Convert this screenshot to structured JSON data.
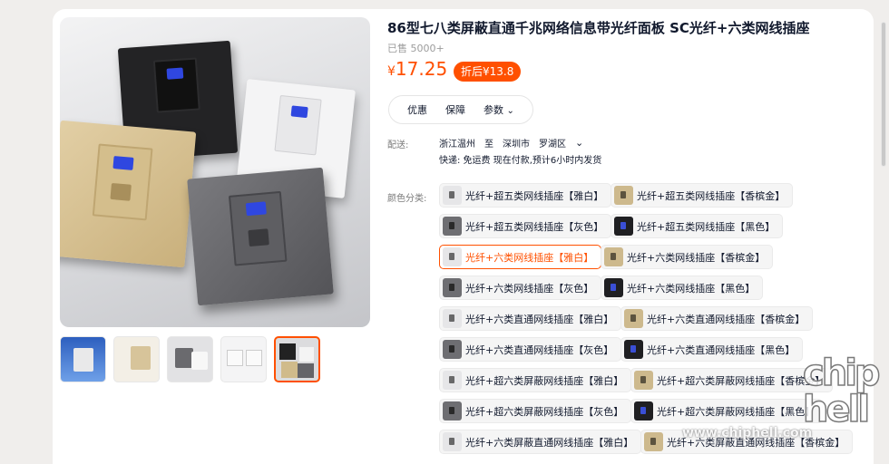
{
  "product": {
    "title": "86型七八类屏蔽直通千兆网络信息带光纤面板 SC光纤+六类网线插座",
    "sold": "已售 5000+",
    "price_symbol": "¥",
    "price": "17.25",
    "coupon": "折后¥13.8"
  },
  "chips": [
    {
      "label": "优惠"
    },
    {
      "label": "保障"
    },
    {
      "label": "参数"
    }
  ],
  "delivery": {
    "label": "配送:",
    "from": "浙江温州",
    "to_word": "至",
    "city": "深圳市",
    "district": "罗湖区",
    "shipping": "快递: 免运费  现在付款,预计6小时内发货"
  },
  "color_label": "颜色分类:",
  "variants": [
    {
      "label": "光纤+超五类网线插座【雅白】",
      "swatch": "white"
    },
    {
      "label": "光纤+超五类网线插座【香槟金】",
      "swatch": "gold"
    },
    {
      "label": "光纤+超五类网线插座【灰色】",
      "swatch": "gray"
    },
    {
      "label": "光纤+超五类网线插座【黑色】",
      "swatch": "black"
    },
    {
      "label": "光纤+六类网线插座【雅白】",
      "swatch": "white",
      "selected": true
    },
    {
      "label": "光纤+六类网线插座【香槟金】",
      "swatch": "gold"
    },
    {
      "label": "光纤+六类网线插座【灰色】",
      "swatch": "gray"
    },
    {
      "label": "光纤+六类网线插座【黑色】",
      "swatch": "black"
    },
    {
      "label": "光纤+六类直通网线插座【雅白】",
      "swatch": "white"
    },
    {
      "label": "光纤+六类直通网线插座【香槟金】",
      "swatch": "gold"
    },
    {
      "label": "光纤+六类直通网线插座【灰色】",
      "swatch": "gray"
    },
    {
      "label": "光纤+六类直通网线插座【黑色】",
      "swatch": "black"
    },
    {
      "label": "光纤+超六类屏蔽网线插座【雅白】",
      "swatch": "white"
    },
    {
      "label": "光纤+超六类屏蔽网线插座【香槟金】",
      "swatch": "gold"
    },
    {
      "label": "光纤+超六类屏蔽网线插座【灰色】",
      "swatch": "gray"
    },
    {
      "label": "光纤+超六类屏蔽网线插座【黑色】",
      "swatch": "black"
    },
    {
      "label": "光纤+六类屏蔽直通网线插座【雅白】",
      "swatch": "white"
    },
    {
      "label": "光纤+六类屏蔽直通网线插座【香槟金】",
      "swatch": "gold"
    }
  ],
  "watermark": {
    "url": "www.chiphell.com",
    "logo": "chip hell"
  },
  "colors": {
    "accent": "#ff5000",
    "price": "#ff4f00",
    "background": "#f0eeec"
  }
}
